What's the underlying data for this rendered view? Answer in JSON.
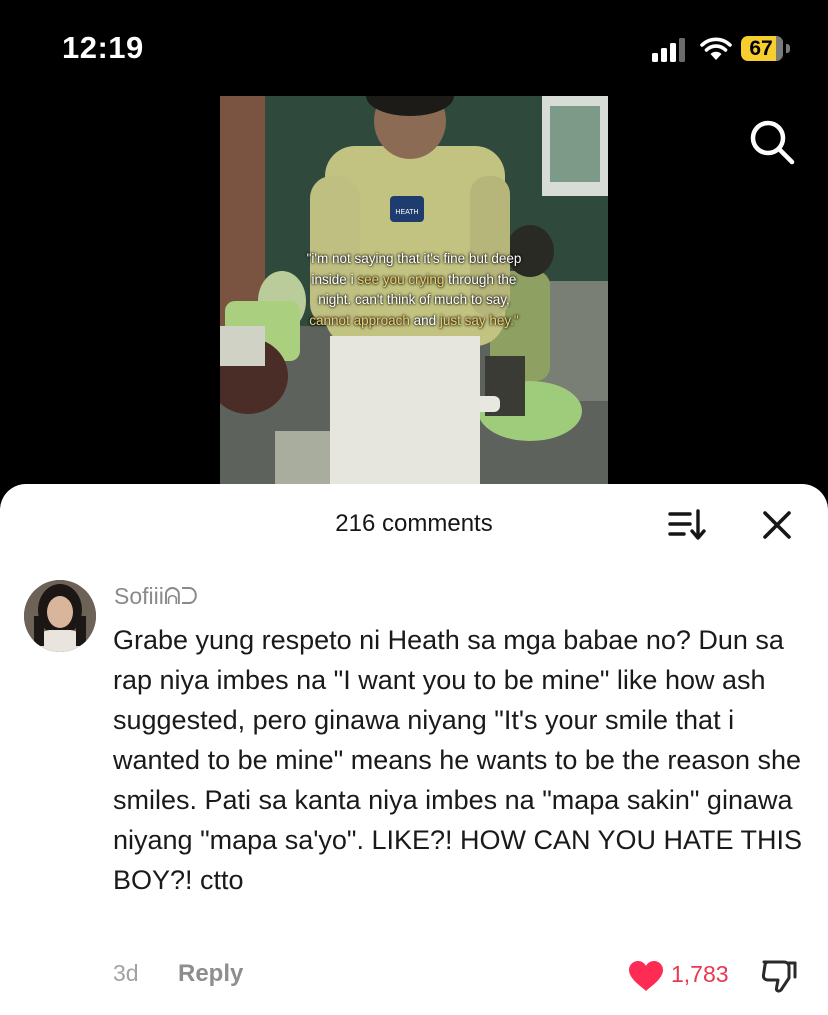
{
  "status_bar": {
    "time": "12:19",
    "battery": "67"
  },
  "video": {
    "caption": {
      "l1": "\"i'm not saying that it's fine but deep",
      "l2a": "inside i ",
      "l2b": "see you crying",
      "l2c": " through the",
      "l3": "night. can't think of much to say,",
      "l4a": "cannot approach",
      "l4b": " and ",
      "l4c": "just say hey.\""
    },
    "jersey_text": "HEATH"
  },
  "comments_panel": {
    "title": "216 comments",
    "icons": {
      "sort": "sort-icon",
      "close": "close-icon"
    }
  },
  "comment": {
    "username": "Sofiii",
    "username_symbol": "ᕱᑐ",
    "text": "Grabe yung respeto ni Heath sa mga babae no? Dun sa rap niya imbes na \"I want you to be mine\" like how ash suggested, pero ginawa niyang \"It's your smile that i wanted to be mine\" means he wants to be the reason she smiles. Pati sa kanta niya imbes na \"mapa sakin\" ginawa niyang \"mapa sa'yo\". LIKE?! HOW CAN YOU HATE THIS BOY?! ctto",
    "age": "3d",
    "reply_label": "Reply",
    "like_count": "1,783"
  },
  "colors": {
    "like": "#fe2c55",
    "battery": "#f6cf2e"
  }
}
